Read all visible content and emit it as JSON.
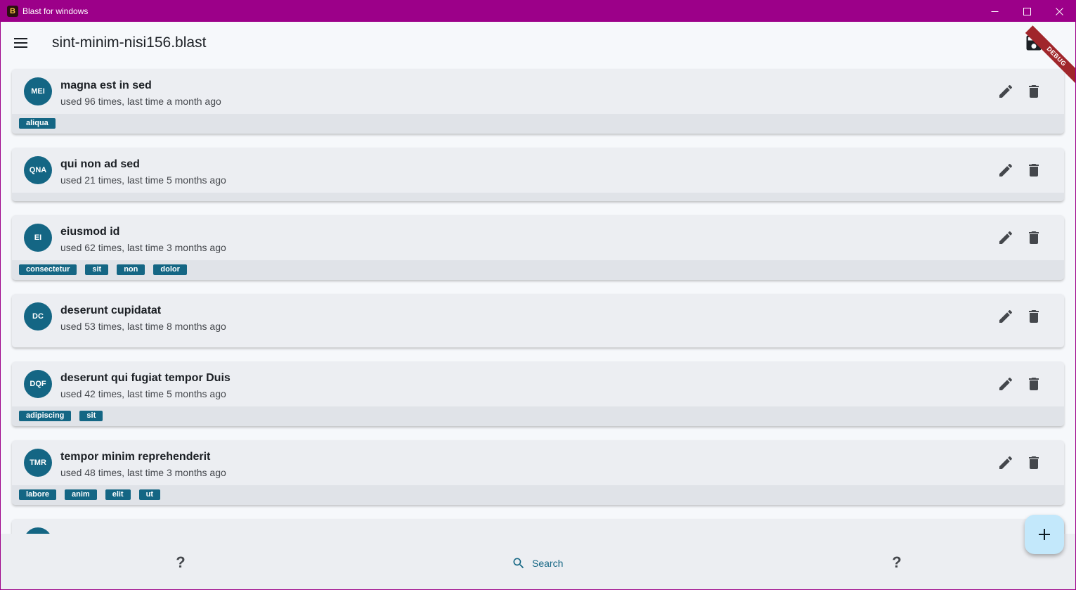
{
  "window": {
    "title": "Blast for windows",
    "app_icon_glyph": "B"
  },
  "appbar": {
    "document_title": "sint-minim-nisi156.blast",
    "debug_banner": "DEBUG"
  },
  "items": [
    {
      "initials": "MEI",
      "title": "magna est in sed",
      "subtitle": "used 96 times, last time a month ago",
      "tags": [
        "aliqua"
      ]
    },
    {
      "initials": "QNA",
      "title": "qui non ad sed",
      "subtitle": "used 21 times, last time 5 months ago",
      "tags": []
    },
    {
      "initials": "EI",
      "title": "eiusmod id",
      "subtitle": "used 62 times, last time 3 months ago",
      "tags": [
        "consectetur",
        "sit",
        "non",
        "dolor"
      ]
    },
    {
      "initials": "DC",
      "title": "deserunt cupidatat",
      "subtitle": "used 53 times, last time 8 months ago",
      "tags": []
    },
    {
      "initials": "DQF",
      "title": "deserunt qui fugiat tempor Duis",
      "subtitle": "used 42 times, last time 5 months ago",
      "tags": [
        "adipiscing",
        "sit"
      ]
    },
    {
      "initials": "TMR",
      "title": "tempor minim reprehenderit",
      "subtitle": "used 48 times, last time 3 months ago",
      "tags": [
        "labore",
        "anim",
        "elit",
        "ut"
      ]
    },
    {
      "initials": "",
      "title": "",
      "subtitle": "",
      "tags": []
    }
  ],
  "bottombar": {
    "left_label": "?",
    "search_label": "Search",
    "right_label": "?"
  },
  "colors": {
    "titlebar": "#9c0089",
    "accent": "#146684",
    "fab": "#c3e8fb"
  }
}
